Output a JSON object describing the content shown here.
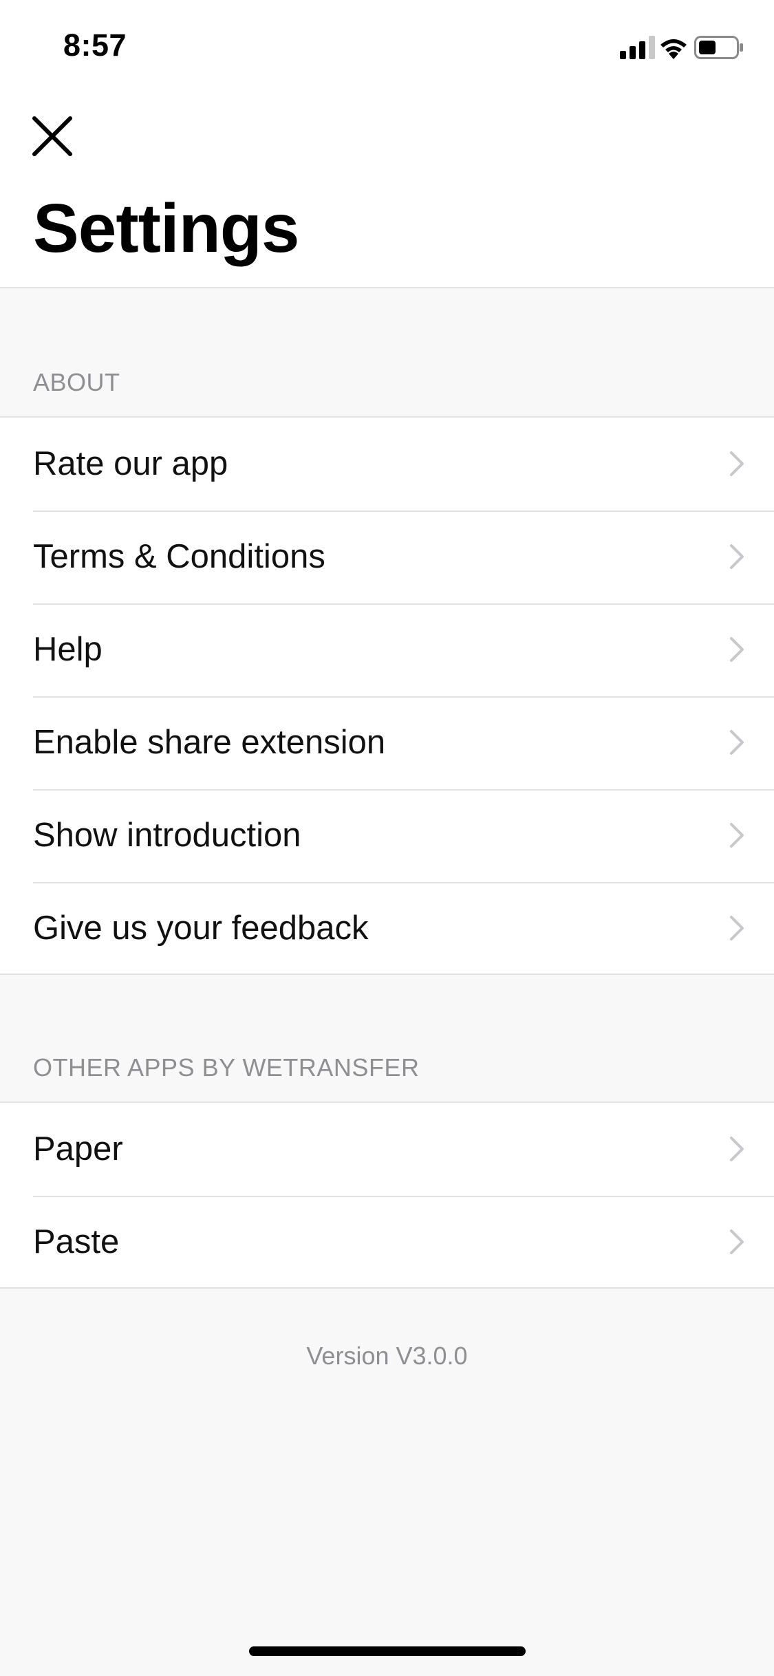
{
  "status_bar": {
    "time": "8:57",
    "icons": [
      "cellular-signal-icon",
      "wifi-icon",
      "battery-icon"
    ]
  },
  "header": {
    "close_icon": "close-icon",
    "title": "Settings"
  },
  "sections": [
    {
      "header": "ABOUT",
      "items": [
        {
          "label": "Rate our app"
        },
        {
          "label": "Terms & Conditions"
        },
        {
          "label": "Help"
        },
        {
          "label": "Enable share extension"
        },
        {
          "label": "Show introduction"
        },
        {
          "label": "Give us your feedback"
        }
      ]
    },
    {
      "header": "OTHER APPS BY WETRANSFER",
      "items": [
        {
          "label": "Paper"
        },
        {
          "label": "Paste"
        }
      ]
    }
  ],
  "footer": {
    "version": "Version V3.0.0"
  },
  "colors": {
    "background": "#f8f8f8",
    "surface": "#ffffff",
    "separator": "#e2e2e2",
    "secondary_text": "#8e8e93",
    "chevron": "#c7c7cc"
  }
}
